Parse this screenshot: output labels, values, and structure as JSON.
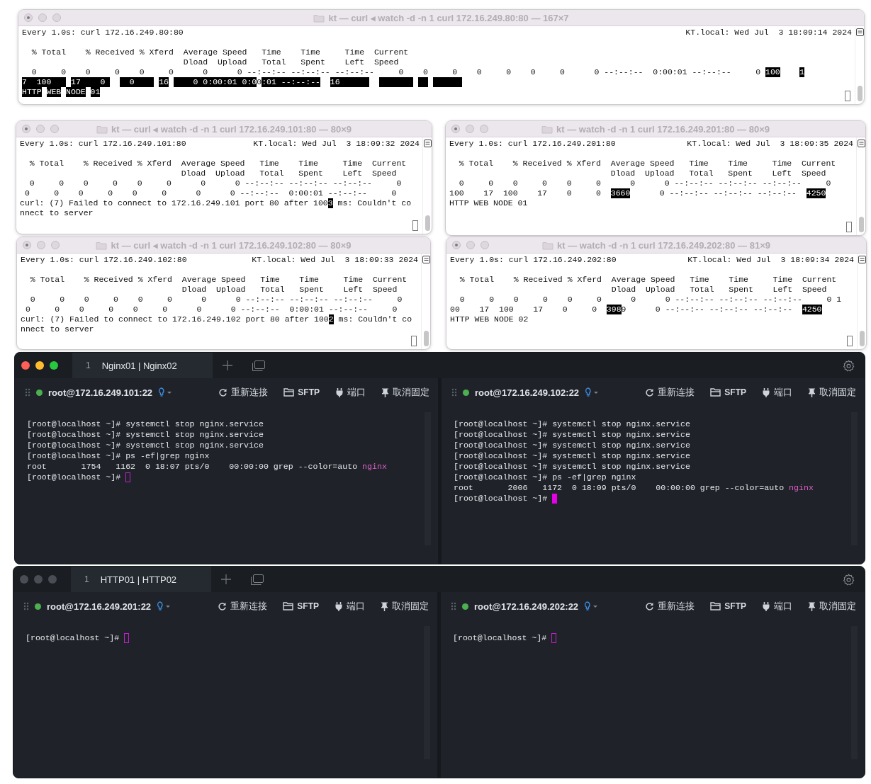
{
  "watch_windows": [
    {
      "title": "kt — curl ◂ watch -d -n 1 curl 172.16.249.80:80 — 167×7",
      "header_left": "Every 1.0s: curl 172.16.249.80:80",
      "header_right": "KT.local: Wed Jul  3 18:09:14 2024",
      "lines": [
        [
          {
            "text": "  % Total    % Received % Xferd  Average Speed   Time    Time     Time  Current",
            "kind": "plain"
          }
        ],
        [
          {
            "text": "                                 Dload  Upload   Total   Spent    Left  Speed",
            "kind": "plain"
          }
        ],
        [
          {
            "text": "  0     0    0     0    0     0      0      0 --:--:-- --:--:-- --:--:--     0    0     0    0     0    0     0      0 --:--:--  0:00:01 --:--:--     0 ",
            "kind": "plain"
          },
          {
            "text": "100",
            "kind": "inverse"
          },
          {
            "kind": "gap"
          },
          {
            "kind": "gap"
          },
          {
            "kind": "gap"
          },
          {
            "kind": "gap"
          },
          {
            "text": "1",
            "kind": "inverse"
          }
        ],
        [
          {
            "text": "7  100   ",
            "kind": "inverse"
          },
          {
            "kind": "gap"
          },
          {
            "text": "17    0 ",
            "kind": "inverse"
          },
          {
            "kind": "gap"
          },
          {
            "kind": "gap"
          },
          {
            "text": "  0    ",
            "kind": "inverse"
          },
          {
            "kind": "gap"
          },
          {
            "text": "16",
            "kind": "inverse"
          },
          {
            "kind": "gap"
          },
          {
            "text": "    0 0:00:01 0:0",
            "kind": "inverse"
          },
          {
            "text": "0",
            "kind": "plain"
          },
          {
            "text": ":01 --:--:--",
            "kind": "inverse"
          },
          {
            "kind": "gap"
          },
          {
            "kind": "gap"
          },
          {
            "text": "16      ",
            "kind": "inverse"
          },
          {
            "kind": "gap"
          },
          {
            "kind": "gap"
          },
          {
            "kind": "blank"
          },
          {
            "kind": "blank"
          },
          {
            "kind": "blank"
          },
          {
            "kind": "blank"
          },
          {
            "kind": "blank"
          },
          {
            "kind": "blank"
          },
          {
            "kind": "blank"
          },
          {
            "kind": "gap"
          },
          {
            "kind": "blank"
          },
          {
            "kind": "blank"
          },
          {
            "kind": "gap"
          },
          {
            "kind": "blank"
          },
          {
            "kind": "blank"
          },
          {
            "kind": "blank"
          },
          {
            "kind": "blank"
          },
          {
            "kind": "blank"
          },
          {
            "kind": "blank"
          }
        ],
        [
          {
            "text": "HTTP",
            "kind": "inverse"
          },
          {
            "kind": "gap"
          },
          {
            "text": "WEB",
            "kind": "inverse"
          },
          {
            "kind": "gap"
          },
          {
            "text": "NODE",
            "kind": "inverse"
          },
          {
            "kind": "gap"
          },
          {
            "text": "01",
            "kind": "inverse"
          }
        ]
      ]
    },
    {
      "title": "kt — curl ◂ watch -d -n 1 curl 172.16.249.101:80 — 80×9",
      "header_left": "Every 1.0s: curl 172.16.249.101:80",
      "header_right": "KT.local: Wed Jul  3 18:09:32 2024",
      "lines": [
        [
          {
            "text": "  % Total    % Received % Xferd  Average Speed   Time    Time     Time  Current",
            "kind": "plain"
          }
        ],
        [
          {
            "text": "                                 Dload  Upload   Total   Spent    Left  Speed",
            "kind": "plain"
          }
        ],
        [
          {
            "text": "  0     0    0     0    0     0      0      0 --:--:-- --:--:-- --:--:--     0",
            "kind": "plain"
          }
        ],
        [
          {
            "text": " 0     0    0     0    0     0      0      0 --:--:--  0:00:01 --:--:--     0",
            "kind": "plain"
          }
        ],
        [
          {
            "text": "curl: (7) Failed to connect to 172.16.249.101 port 80 after 100",
            "kind": "plain"
          },
          {
            "text": "3",
            "kind": "inverse"
          },
          {
            "text": " ms: Couldn't co",
            "kind": "plain"
          }
        ],
        [
          {
            "text": "nnect to server",
            "kind": "plain"
          }
        ]
      ]
    },
    {
      "title": "kt — watch -d -n 1 curl 172.16.249.201:80 — 80×9",
      "header_left": "Every 1.0s: curl 172.16.249.201:80",
      "header_right": "KT.local: Wed Jul  3 18:09:35 2024",
      "lines": [
        [
          {
            "text": "  % Total    % Received % Xferd  Average Speed   Time    Time     Time  Current",
            "kind": "plain"
          }
        ],
        [
          {
            "text": "                                 Dload  Upload   Total   Spent    Left  Speed",
            "kind": "plain"
          }
        ],
        [
          {
            "text": "  0     0    0     0    0     0      0      0 --:--:-- --:--:-- --:--:--     0",
            "kind": "plain"
          }
        ],
        [
          {
            "text": "100    17  100    17    0     0  ",
            "kind": "plain"
          },
          {
            "text": "3660",
            "kind": "inverse"
          },
          {
            "text": "      0 --:--:-- --:--:-- --:--:--  ",
            "kind": "plain"
          },
          {
            "text": "4250",
            "kind": "inverse"
          }
        ],
        [
          {
            "text": "HTTP WEB NODE 01",
            "kind": "plain"
          }
        ]
      ]
    },
    {
      "title": "kt — curl ◂ watch -d -n 1 curl 172.16.249.102:80 — 80×9",
      "header_left": "Every 1.0s: curl 172.16.249.102:80",
      "header_right": "KT.local: Wed Jul  3 18:09:33 2024",
      "lines": [
        [
          {
            "text": "  % Total    % Received % Xferd  Average Speed   Time    Time     Time  Current",
            "kind": "plain"
          }
        ],
        [
          {
            "text": "                                 Dload  Upload   Total   Spent    Left  Speed",
            "kind": "plain"
          }
        ],
        [
          {
            "text": "  0     0    0     0    0     0      0      0 --:--:-- --:--:-- --:--:--     0",
            "kind": "plain"
          }
        ],
        [
          {
            "text": " 0     0    0     0    0     0      0      0 --:--:--  0:00:01 --:--:--     0",
            "kind": "plain"
          }
        ],
        [
          {
            "text": "curl: (7) Failed to connect to 172.16.249.102 port 80 after 100",
            "kind": "plain"
          },
          {
            "text": "2",
            "kind": "inverse"
          },
          {
            "text": " ms: Couldn't co",
            "kind": "plain"
          }
        ],
        [
          {
            "text": "nnect to server",
            "kind": "plain"
          }
        ]
      ]
    },
    {
      "title": "kt — watch -d -n 1 curl 172.16.249.202:80 — 81×9",
      "header_left": "Every 1.0s: curl 172.16.249.202:80",
      "header_right": "KT.local: Wed Jul  3 18:09:34 2024",
      "lines": [
        [
          {
            "text": "  % Total    % Received % Xferd  Average Speed   Time    Time     Time  Current",
            "kind": "plain"
          }
        ],
        [
          {
            "text": "                                 Dload  Upload   Total   Spent    Left  Speed",
            "kind": "plain"
          }
        ],
        [
          {
            "text": "  0     0    0     0    0     0      0      0 --:--:-- --:--:-- --:--:--     0 1",
            "kind": "plain"
          }
        ],
        [
          {
            "text": "00    17  100    17    0     0  ",
            "kind": "plain"
          },
          {
            "text": "398",
            "kind": "inverse"
          },
          {
            "text": "9      0 --:--:-- --:--:-- --:--:--  ",
            "kind": "plain"
          },
          {
            "text": "4250",
            "kind": "inverse"
          }
        ],
        [
          {
            "text": "HTTP WEB NODE 02",
            "kind": "plain"
          }
        ]
      ]
    }
  ],
  "ssh_windows": [
    {
      "active": true,
      "tabs": [
        {
          "number": "1",
          "label": "Nginx01 | Nginx02",
          "selected": true
        }
      ],
      "panes": [
        {
          "host": "root@172.16.249.101:22",
          "connected": true,
          "cursor_solid": false,
          "actions": [
            {
              "kind": "reconnect",
              "label": "重新连接"
            },
            {
              "kind": "sftp",
              "label": "SFTP"
            },
            {
              "kind": "port",
              "label": "端口"
            },
            {
              "kind": "unpin",
              "label": "取消固定"
            }
          ],
          "lines": [
            [
              {
                "text": "[root@localhost ~]# systemctl stop nginx.service",
                "kind": "plain"
              }
            ],
            [
              {
                "text": "[root@localhost ~]# systemctl stop nginx.service",
                "kind": "plain"
              }
            ],
            [
              {
                "text": "[root@localhost ~]# systemctl stop nginx.service",
                "kind": "plain"
              }
            ],
            [
              {
                "text": "[root@localhost ~]# ps -ef|grep nginx",
                "kind": "plain"
              }
            ],
            [
              {
                "text": "root       1754   1162  0 18:07 pts/0    00:00:00 grep --color=auto ",
                "kind": "plain"
              },
              {
                "text": "nginx",
                "kind": "match"
              }
            ],
            [
              {
                "text": "[root@localhost ~]# ",
                "kind": "plain"
              }
            ]
          ]
        },
        {
          "host": "root@172.16.249.102:22",
          "connected": true,
          "cursor_solid": true,
          "actions": [
            {
              "kind": "reconnect",
              "label": "重新连接"
            },
            {
              "kind": "sftp",
              "label": "SFTP"
            },
            {
              "kind": "port",
              "label": "端口"
            },
            {
              "kind": "unpin",
              "label": "取消固定"
            }
          ],
          "lines": [
            [
              {
                "text": "[root@localhost ~]# systemctl stop nginx.service",
                "kind": "plain"
              }
            ],
            [
              {
                "text": "[root@localhost ~]# systemctl stop nginx.service",
                "kind": "plain"
              }
            ],
            [
              {
                "text": "[root@localhost ~]# systemctl stop nginx.service",
                "kind": "plain"
              }
            ],
            [
              {
                "text": "[root@localhost ~]# systemctl stop nginx.service",
                "kind": "plain"
              }
            ],
            [
              {
                "text": "[root@localhost ~]# systemctl stop nginx.service",
                "kind": "plain"
              }
            ],
            [
              {
                "text": "[root@localhost ~]# ps -ef|grep nginx",
                "kind": "plain"
              }
            ],
            [
              {
                "text": "root       2006   1172  0 18:09 pts/0    00:00:00 grep --color=auto ",
                "kind": "plain"
              },
              {
                "text": "nginx",
                "kind": "match"
              }
            ],
            [
              {
                "text": "[root@localhost ~]# ",
                "kind": "plain"
              }
            ]
          ]
        }
      ]
    },
    {
      "active": false,
      "tabs": [
        {
          "number": "1",
          "label": "HTTP01 | HTTP02",
          "selected": true
        }
      ],
      "panes": [
        {
          "host": "root@172.16.249.201:22",
          "connected": true,
          "cursor_solid": false,
          "actions": [
            {
              "kind": "reconnect",
              "label": "重新连接"
            },
            {
              "kind": "sftp",
              "label": "SFTP"
            },
            {
              "kind": "port",
              "label": "端口"
            },
            {
              "kind": "unpin",
              "label": "取消固定"
            }
          ],
          "lines": [
            [
              {
                "text": "[root@localhost ~]# ",
                "kind": "plain"
              }
            ]
          ]
        },
        {
          "host": "root@172.16.249.202:22",
          "connected": true,
          "cursor_solid": false,
          "actions": [
            {
              "kind": "reconnect",
              "label": "重新连接"
            },
            {
              "kind": "sftp",
              "label": "SFTP"
            },
            {
              "kind": "port",
              "label": "端口"
            },
            {
              "kind": "unpin",
              "label": "取消固定"
            }
          ],
          "lines": [
            [
              {
                "text": "[root@localhost ~]# ",
                "kind": "plain"
              }
            ]
          ]
        }
      ]
    }
  ]
}
